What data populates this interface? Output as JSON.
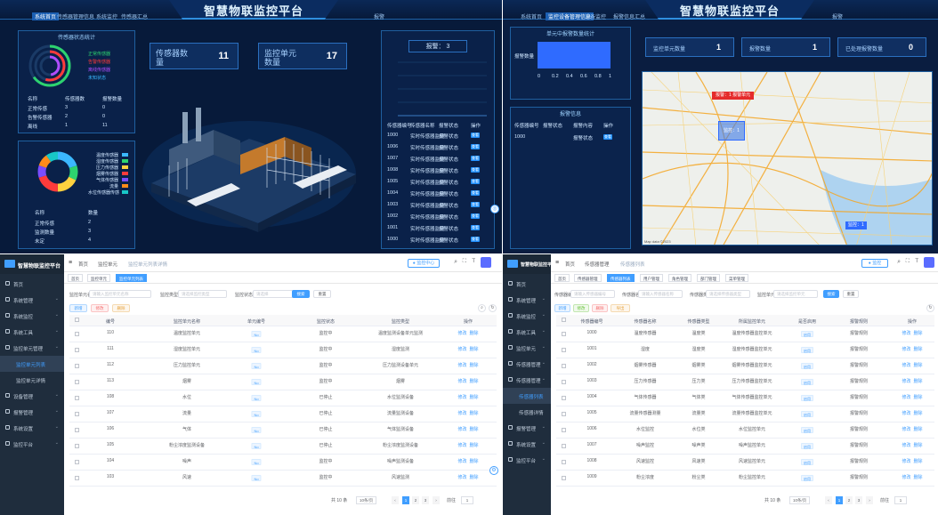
{
  "dashboard1": {
    "title": "智慧物联监控平台",
    "nav_tabs": [
      "系统首页",
      "传感器管理信息",
      "系统监控",
      "传感器汇总",
      "报警"
    ],
    "ring_panel": {
      "title": "传感器状态统计",
      "legend": [
        "正常传感器",
        "告警传感器",
        "离线传感器",
        "未知状态"
      ],
      "table_headers": [
        "名称",
        "传感器数",
        "报警数量"
      ],
      "rows": [
        [
          "正常传感",
          "3",
          "0"
        ],
        [
          "告警传感器",
          "2",
          "0"
        ],
        [
          "离线",
          "1",
          "11"
        ]
      ]
    },
    "donut_panel": {
      "legend": [
        "温度传感器",
        "湿度传感器",
        "压力传感器",
        "烟雾传感器",
        "气体传感器",
        "流量",
        "水位传感器传感"
      ],
      "colors": [
        "#3bb8ff",
        "#2dd36f",
        "#ffd23f",
        "#ff3b3b",
        "#7a4dff",
        "#ff8c1a",
        "#18c7c7"
      ],
      "table_headers": [
        "名称",
        "数量"
      ],
      "rows": [
        [
          "正常传感",
          "2"
        ],
        [
          "监测数量",
          "3"
        ],
        [
          "未定",
          "4"
        ]
      ]
    },
    "stat_sensors": {
      "label": "传感器数量",
      "value": "11"
    },
    "stat_units": {
      "label": "监控单元数量",
      "value": "17"
    },
    "alarm_panel": {
      "count_label": "报警：",
      "count_value": "3",
      "table_headers": [
        "传感器编号",
        "传感器名称",
        "报警状态",
        "操作"
      ],
      "rows": [
        [
          "1000",
          "实时传感器监测",
          "报警状态",
          "查看"
        ],
        [
          "1006",
          "实时传感器监测",
          "报警状态",
          "查看"
        ],
        [
          "1007",
          "实时传感器监测",
          "报警状态",
          "查看"
        ],
        [
          "1008",
          "实时传感器监测",
          "报警状态",
          "查看"
        ],
        [
          "1005",
          "实时传感器监测",
          "报警状态",
          "查看"
        ],
        [
          "1004",
          "实时传感器监测",
          "报警状态",
          "查看"
        ],
        [
          "1003",
          "实时传感器监测",
          "报警状态",
          "查看"
        ],
        [
          "1002",
          "实时传感器监测",
          "报警状态",
          "查看"
        ],
        [
          "1001",
          "实时传感器监测",
          "报警状态",
          "查看"
        ],
        [
          "1000",
          "实时传感器监测",
          "报警状态",
          "查看"
        ]
      ]
    }
  },
  "dashboard2": {
    "title": "智慧物联监控平台",
    "nav_tabs": [
      "系统首页",
      "监控设备管理信息",
      "设备监控",
      "报警信息汇总",
      "报警"
    ],
    "bar_panel": {
      "title": "单元中报警数量统计",
      "bar_label": "报警数量",
      "ticks": [
        "0",
        "0.2",
        "0.4",
        "0.6",
        "0.8",
        "1"
      ]
    },
    "alarm_list": {
      "title": "报警信息",
      "headers": [
        "传感器编号",
        "报警状态",
        "报警内容",
        "操作"
      ],
      "row": [
        "1000",
        "",
        "报警状态",
        "查看"
      ]
    },
    "stats": [
      {
        "label": "监控单元数量",
        "value": "1"
      },
      {
        "label": "报警数量",
        "value": "1"
      },
      {
        "label": "已处理报警数量",
        "value": "0"
      }
    ],
    "map_markers": [
      "报警：1 报警单元",
      "监控：1",
      "监控：1"
    ],
    "map_footer": "Map data ©2023"
  },
  "admin1": {
    "logo": "智慧物联监控平台",
    "menu": [
      "首页",
      "系统管理",
      "系统监控",
      "系统工具",
      "监控单元管理",
      "监控单元列表",
      "监控单元详情",
      "设备管理",
      "报警管理",
      "系统设置",
      "监控平台"
    ],
    "breadcrumb": [
      "首页",
      "监控单元",
      "监控单元列表详情"
    ],
    "tags": [
      "首页",
      "监控单元",
      "监控单元列表"
    ],
    "search": {
      "label1": "监控单元名称",
      "ph1": "请输入监控单元名称",
      "label2": "监控类型",
      "ph2": "请选择监控类型",
      "label3": "监控状态",
      "ph3": "请选择",
      "search_btn": "搜索",
      "reset_btn": "重置"
    },
    "actions": [
      "新增",
      "修改",
      "删除"
    ],
    "headers": [
      "编号",
      "监控单元名称",
      "单元编号",
      "监控状态",
      "监控类型",
      "操作"
    ],
    "rows": [
      [
        "110",
        "温度监控单元",
        "No",
        "监控中",
        "温度监测设备单元监测"
      ],
      [
        "111",
        "湿度监控单元",
        "No",
        "监控中",
        "湿度监测"
      ],
      [
        "112",
        "压力监控单元",
        "No",
        "监控中",
        "压力监测设备单元"
      ],
      [
        "113",
        "烟雾",
        "No",
        "监控中",
        "烟雾"
      ],
      [
        "108",
        "水位",
        "No",
        "已停止",
        "水位监测设备"
      ],
      [
        "107",
        "流量",
        "No",
        "已停止",
        "流量监测设备"
      ],
      [
        "106",
        "气体",
        "No",
        "已停止",
        "气体监测设备"
      ],
      [
        "105",
        "粉尘浓度监测设备",
        "No",
        "已停止",
        "粉尘浓度监测设备"
      ],
      [
        "104",
        "噪声",
        "No",
        "监控中",
        "噪声监测设备"
      ],
      [
        "103",
        "风速",
        "No",
        "监控中",
        "风速监测"
      ]
    ],
    "row_actions": [
      "修改",
      "删除"
    ],
    "pagination": {
      "total": "共 10 条",
      "size": "10条/页",
      "pages": [
        "1",
        "2",
        "3"
      ],
      "goto": "前往",
      "page": "1"
    }
  },
  "admin2": {
    "logo": "智慧物联监控平台",
    "menu": [
      "首页",
      "系统管理",
      "系统监控",
      "系统工具",
      "监控单元",
      "传感器管理",
      "传感器管理",
      "传感器列表",
      "传感器详情",
      "报警管理",
      "系统设置",
      "监控平台"
    ],
    "breadcrumb": [
      "首页",
      "传感器管理",
      "传感器列表"
    ],
    "tags": [
      "首页",
      "传感器管理",
      "传感器列表",
      "用户管理",
      "角色管理",
      "部门管理",
      "菜单管理"
    ],
    "search": {
      "label1": "传感器编号",
      "ph1": "请输入传感器编号",
      "label2": "传感器名称",
      "ph2": "请输入传感器名称",
      "label3": "传感器类型",
      "ph3": "请选择传感器类型",
      "label4": "监控单元",
      "ph4": "请选择监控单元",
      "search_btn": "搜索",
      "reset_btn": "重置"
    },
    "actions": [
      "新增",
      "修改",
      "删除",
      "导出"
    ],
    "headers": [
      "传感器编号",
      "传感器名称",
      "传感器类型",
      "所属监控单元",
      "是否启用",
      "报警规则",
      "操作"
    ],
    "rows": [
      [
        "1000",
        "温度传感器",
        "温度类",
        "温度传感器监控单元",
        "启用",
        "报警规则"
      ],
      [
        "1001",
        "湿度",
        "湿度类",
        "湿度传感器监控单元",
        "启用",
        "报警规则"
      ],
      [
        "1002",
        "烟雾传感器",
        "烟雾类",
        "烟雾传感器监控单元",
        "启用",
        "报警规则"
      ],
      [
        "1003",
        "压力传感器",
        "压力类",
        "压力传感器监控单元",
        "启用",
        "报警规则"
      ],
      [
        "1004",
        "气体传感器",
        "气体类",
        "气体传感器监控单元",
        "启用",
        "报警规则"
      ],
      [
        "1005",
        "流量传感器测量",
        "流量类",
        "流量传感器监控单元",
        "启用",
        "报警规则"
      ],
      [
        "1006",
        "水位监控",
        "水位类",
        "水位监控单元",
        "启用",
        "报警规则"
      ],
      [
        "1007",
        "噪声监控",
        "噪声类",
        "噪声监控单元",
        "启用",
        "报警规则"
      ],
      [
        "1008",
        "风速监控",
        "风速类",
        "风速监控单元",
        "启用",
        "报警规则"
      ],
      [
        "1009",
        "粉尘浓度",
        "粉尘类",
        "粉尘监控单元",
        "启用",
        "报警规则"
      ]
    ],
    "row_actions": [
      "修改",
      "删除"
    ],
    "pagination": {
      "total": "共 10 条",
      "size": "10条/页",
      "pages": [
        "1",
        "2",
        "3"
      ],
      "goto": "前往",
      "page": "1"
    }
  }
}
